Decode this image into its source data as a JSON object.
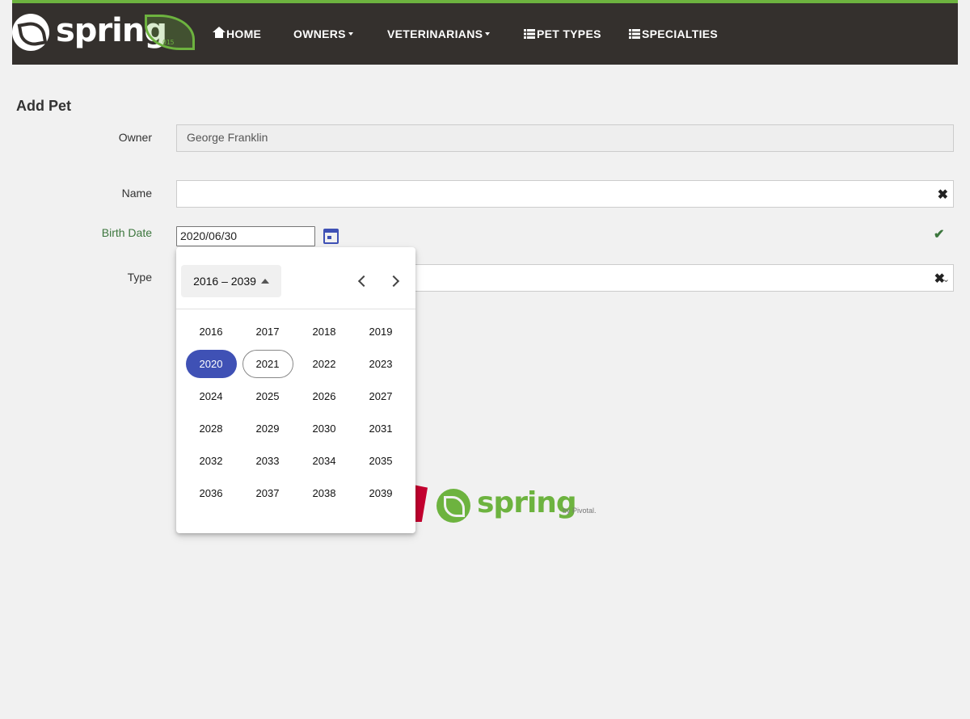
{
  "nav": {
    "brand": "spring",
    "brand_badge": "015",
    "items": [
      {
        "label": "HOME",
        "icon": "home-icon"
      },
      {
        "label": "OWNERS",
        "dropdown": true
      },
      {
        "label": "VETERINARIANS",
        "dropdown": true
      },
      {
        "label": "PET TYPES",
        "icon": "list-icon"
      },
      {
        "label": "SPECIALTIES",
        "icon": "list-icon"
      }
    ]
  },
  "form": {
    "title": "Add Pet",
    "owner_label": "Owner",
    "owner_value": "George Franklin",
    "name_label": "Name",
    "name_value": "",
    "birth_label": "Birth Date",
    "birth_value": "2020/06/30",
    "type_label": "Type"
  },
  "datepicker": {
    "period_label": "2016 – 2039",
    "selected_year": "2020",
    "today_year": "2021",
    "years": [
      "2016",
      "2017",
      "2018",
      "2019",
      "2020",
      "2021",
      "2022",
      "2023",
      "2024",
      "2025",
      "2026",
      "2027",
      "2028",
      "2029",
      "2030",
      "2031",
      "2032",
      "2033",
      "2034",
      "2035",
      "2036",
      "2037",
      "2038",
      "2039"
    ]
  },
  "footer": {
    "spring_word": "spring",
    "by_text": "by Pivotal."
  },
  "colors": {
    "navbar_bg": "#34302d",
    "brand_green": "#6db33f",
    "valid_green": "#3c763d",
    "picker_accent": "#3f51b5"
  }
}
